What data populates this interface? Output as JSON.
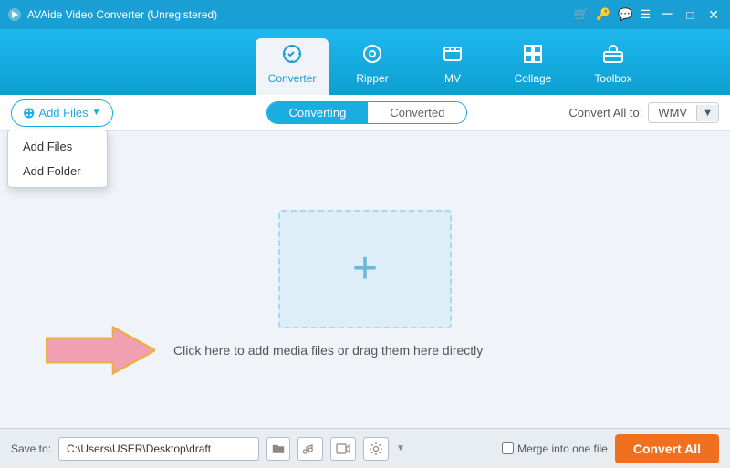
{
  "titlebar": {
    "title": "AVAide Video Converter (Unregistered)",
    "controls": [
      "cart",
      "key",
      "chat",
      "menu",
      "minimize",
      "maximize",
      "close"
    ]
  },
  "navbar": {
    "items": [
      {
        "id": "converter",
        "label": "Converter",
        "icon": "🔄",
        "active": true
      },
      {
        "id": "ripper",
        "label": "Ripper",
        "icon": "⊙",
        "active": false
      },
      {
        "id": "mv",
        "label": "MV",
        "icon": "🖼",
        "active": false
      },
      {
        "id": "collage",
        "label": "Collage",
        "icon": "⊞",
        "active": false
      },
      {
        "id": "toolbox",
        "label": "Toolbox",
        "icon": "🧰",
        "active": false
      }
    ]
  },
  "toolbar": {
    "add_files_label": "Add Files",
    "dropdown_items": [
      "Add Files",
      "Add Folder"
    ],
    "tabs": [
      "Converting",
      "Converted"
    ],
    "active_tab": "Converting",
    "convert_all_to_label": "Convert All to:",
    "format": "WMV"
  },
  "main": {
    "drop_plus": "+",
    "hint_text": "Click here to add media files or drag them here directly"
  },
  "bottombar": {
    "save_to_label": "Save to:",
    "save_path": "C:\\Users\\USER\\Desktop\\draft",
    "merge_label": "Merge into one file",
    "convert_all_label": "Convert All"
  }
}
